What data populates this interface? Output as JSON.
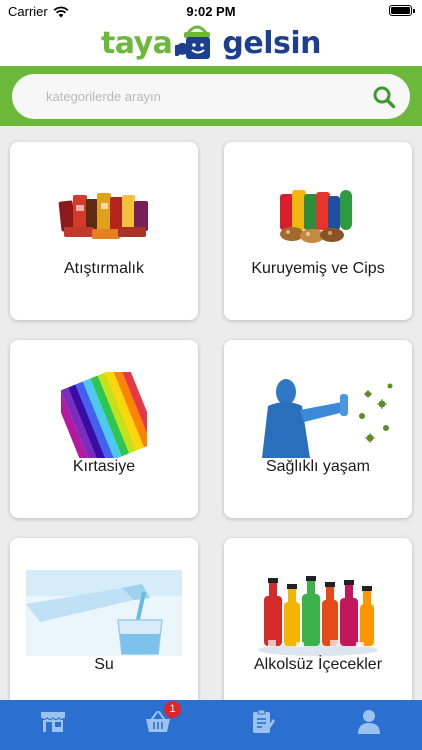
{
  "status_bar": {
    "carrier": "Carrier",
    "time": "9:02 PM"
  },
  "brand": {
    "logo_left": "taya",
    "logo_right": "gelsin",
    "color_green": "#6cb83a",
    "color_blue": "#1d3f8f"
  },
  "search": {
    "placeholder": "kategorilerde arayın",
    "icon": "search-icon"
  },
  "categories": [
    {
      "label": "Atıştırmalık",
      "icon": "snacks-image"
    },
    {
      "label": "Kuruyemiş ve Cips",
      "icon": "nuts-chips-image"
    },
    {
      "label": "Kırtasiye",
      "icon": "colored-pencils-image"
    },
    {
      "label": "Sağlıklı yaşam",
      "icon": "healthy-living-image"
    },
    {
      "label": "Su",
      "icon": "water-image"
    },
    {
      "label": "Alkolsüz İçecekler",
      "icon": "soft-drinks-image"
    }
  ],
  "tab_bar": {
    "color": "#2b6fd0",
    "tabs": [
      {
        "icon": "store-icon"
      },
      {
        "icon": "basket-icon",
        "badge": "1"
      },
      {
        "icon": "order-list-icon"
      },
      {
        "icon": "user-icon"
      }
    ]
  }
}
